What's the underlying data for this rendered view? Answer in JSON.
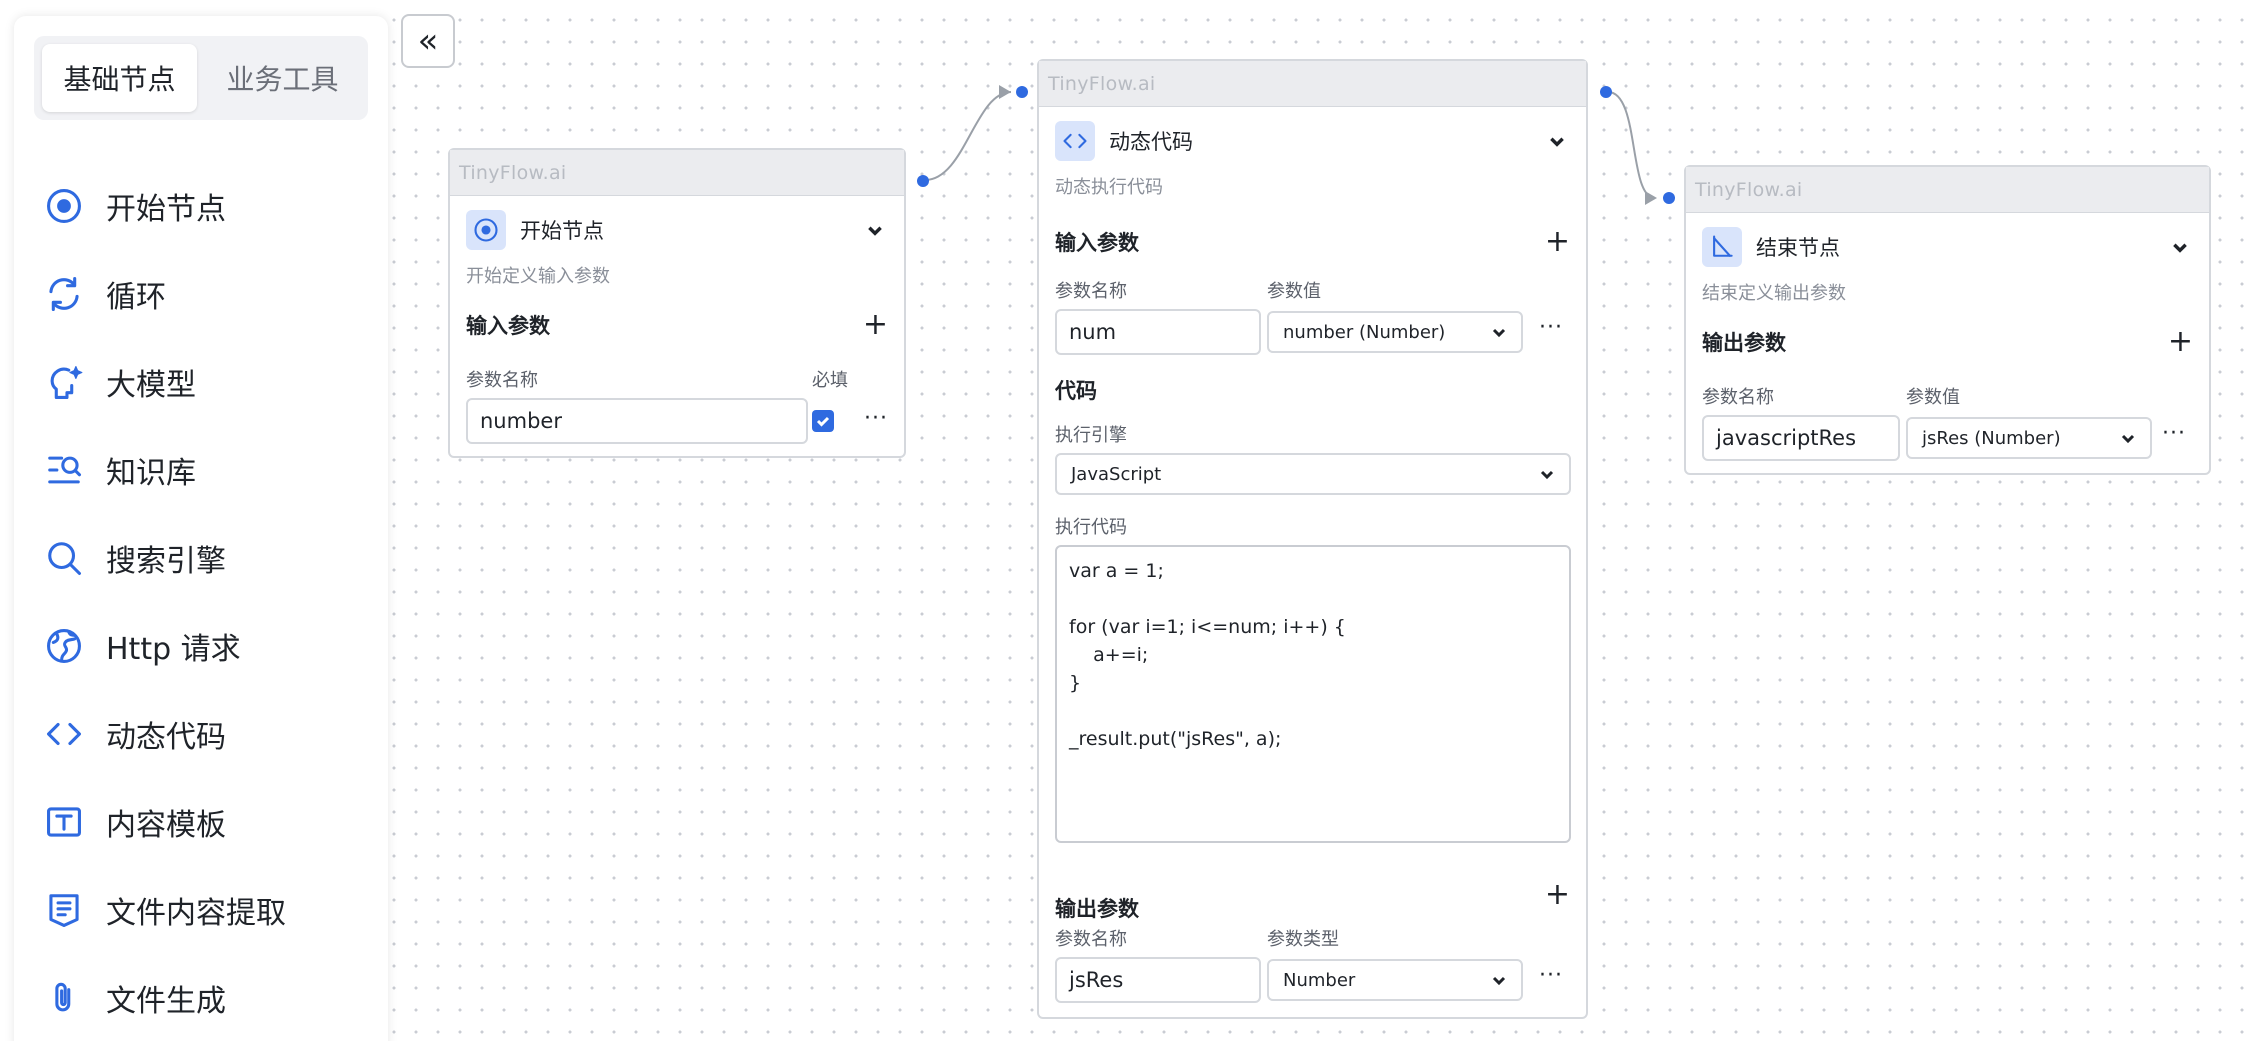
{
  "sidebar": {
    "tabs": [
      {
        "label": "基础节点",
        "active": true
      },
      {
        "label": "业务工具",
        "active": false
      }
    ],
    "items": [
      {
        "label": "开始节点",
        "icon": "start-icon"
      },
      {
        "label": "循环",
        "icon": "loop-icon"
      },
      {
        "label": "大模型",
        "icon": "llm-icon"
      },
      {
        "label": "知识库",
        "icon": "knowledge-icon"
      },
      {
        "label": "搜索引擎",
        "icon": "search-icon"
      },
      {
        "label": "Http 请求",
        "icon": "globe-icon"
      },
      {
        "label": "动态代码",
        "icon": "code-icon"
      },
      {
        "label": "内容模板",
        "icon": "template-icon"
      },
      {
        "label": "文件内容提取",
        "icon": "file-extract-icon"
      },
      {
        "label": "文件生成",
        "icon": "paperclip-icon"
      }
    ]
  },
  "collapse_label": "«",
  "brand": "TinyFlow.ai",
  "start_node": {
    "title": "开始节点",
    "desc": "开始定义输入参数",
    "section": "输入参数",
    "col_name": "参数名称",
    "col_required": "必填",
    "param_name": "number",
    "required": true
  },
  "code_node": {
    "title": "动态代码",
    "desc": "动态执行代码",
    "input_section": "输入参数",
    "col_name": "参数名称",
    "col_value": "参数值",
    "input_name": "num",
    "input_value": "number (Number)",
    "code_section": "代码",
    "engine_label": "执行引擎",
    "engine_value": "JavaScript",
    "code_label": "执行代码",
    "code": "var a = 1;\n\nfor (var i=1; i<=num; i++) {\n    a+=i;\n}\n\n_result.put(\"jsRes\", a);",
    "output_section": "输出参数",
    "out_col_name": "参数名称",
    "out_col_type": "参数类型",
    "output_name": "jsRes",
    "output_type": "Number"
  },
  "end_node": {
    "title": "结束节点",
    "desc": "结束定义输出参数",
    "section": "输出参数",
    "col_name": "参数名称",
    "col_value": "参数值",
    "param_name": "javascriptRes",
    "param_value": "jsRes (Number)"
  },
  "colors": {
    "accent": "#2f6ae0",
    "node_header": "#ebecef",
    "border": "#d5d8dd"
  }
}
